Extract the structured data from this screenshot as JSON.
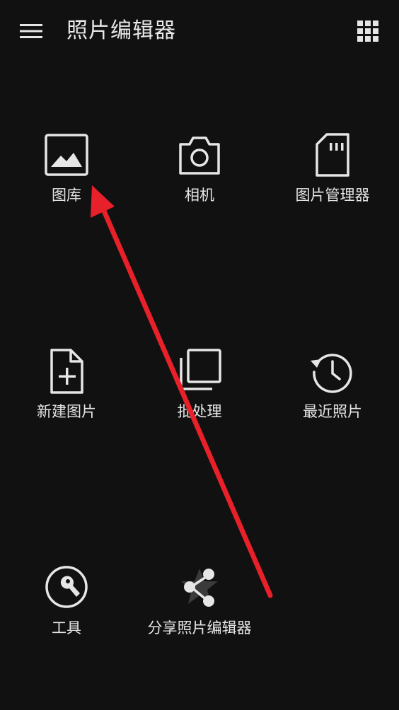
{
  "header": {
    "title": "照片编辑器",
    "menu_icon": "hamburger-menu-icon",
    "apps_icon": "grid-apps-icon"
  },
  "tiles": [
    {
      "label": "图库",
      "icon": "gallery-image-icon"
    },
    {
      "label": "相机",
      "icon": "camera-icon"
    },
    {
      "label": "图片管理器",
      "icon": "sd-card-icon"
    },
    {
      "label": "新建图片",
      "icon": "new-file-icon"
    },
    {
      "label": "批处理",
      "icon": "batch-stack-icon"
    },
    {
      "label": "最近照片",
      "icon": "history-clock-icon"
    },
    {
      "label": "工具",
      "icon": "wrench-tool-icon"
    },
    {
      "label": "分享照片编辑器",
      "icon": "share-icon"
    }
  ],
  "colors": {
    "background": "#111111",
    "icon": "#e6e6e6",
    "annotation_arrow": "#e8202a"
  }
}
